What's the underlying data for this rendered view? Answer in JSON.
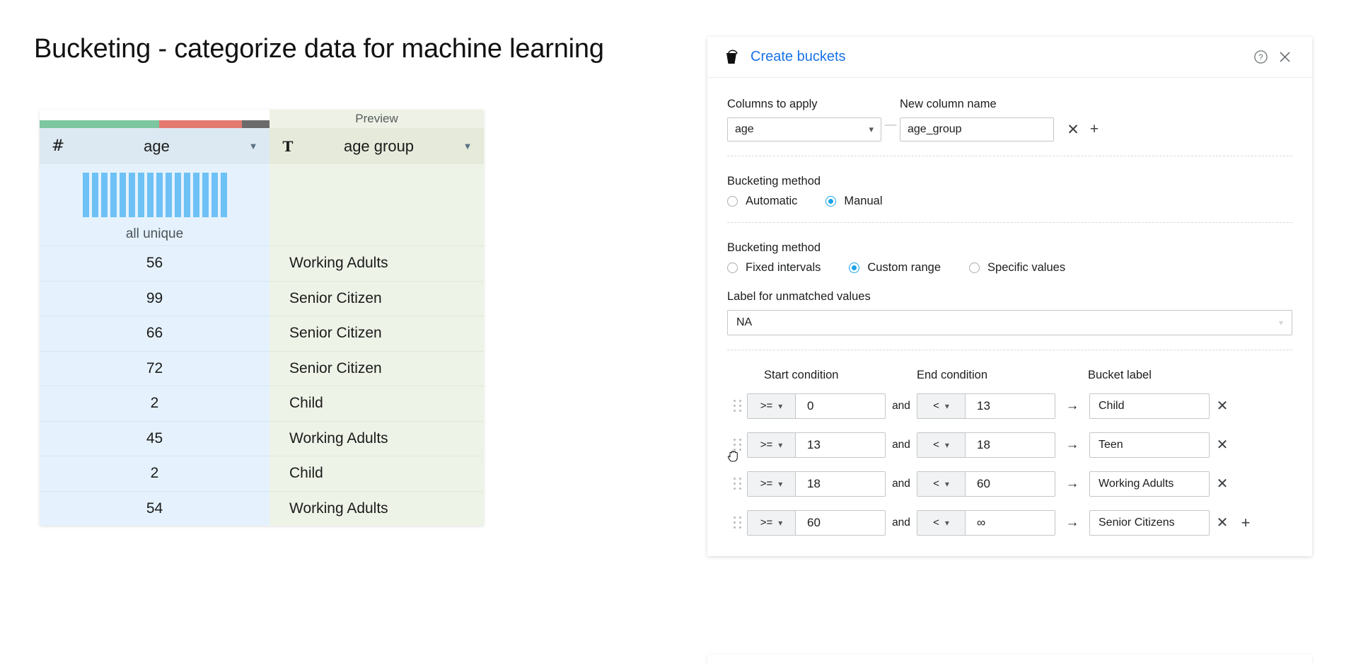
{
  "page": {
    "title": "Bucketing - categorize data for machine learning"
  },
  "table": {
    "preview_label": "Preview",
    "columns": [
      {
        "type_icon": "hash-icon",
        "type_glyph": "#",
        "name": "age",
        "caret": "▼"
      },
      {
        "type_icon": "text-type-icon",
        "type_glyph": "T",
        "name": "age group",
        "caret": "▼"
      }
    ],
    "quality_bar": {
      "green_pct": 52,
      "red_pct": 36,
      "gray_pct": 12,
      "green_color": "#7cc6a0",
      "red_color": "#e4796f",
      "gray_color": "#6b6b6b"
    },
    "histogram": {
      "bar_color": "#6ec1f5",
      "bar_count": 16,
      "summary_label": "all unique"
    },
    "rows": [
      {
        "age": "56",
        "age_group": "Working Adults"
      },
      {
        "age": "99",
        "age_group": "Senior Citizen"
      },
      {
        "age": "66",
        "age_group": "Senior Citizen"
      },
      {
        "age": "72",
        "age_group": "Senior Citizen"
      },
      {
        "age": "2",
        "age_group": "Child"
      },
      {
        "age": "45",
        "age_group": "Working Adults"
      },
      {
        "age": "2",
        "age_group": "Child"
      },
      {
        "age": "54",
        "age_group": "Working Adults"
      }
    ]
  },
  "dialog": {
    "title": "Create buckets",
    "title_color": "#1a73e8",
    "icon": "bucket-icon",
    "help_icon": "help-circle-icon",
    "close_icon": "close-icon",
    "columns_section": {
      "columns_to_apply_label": "Columns to apply",
      "new_column_name_label": "New column name",
      "source_column": "age",
      "join_dash": "—",
      "new_column_name": "age_group",
      "remove_icon": "✕",
      "add_icon": "+"
    },
    "method_section": {
      "label": "Bucketing method",
      "options": [
        {
          "label": "Automatic",
          "selected": false
        },
        {
          "label": "Manual",
          "selected": true
        }
      ]
    },
    "range_section": {
      "label": "Bucketing method",
      "options": [
        {
          "label": "Fixed intervals",
          "selected": false
        },
        {
          "label": "Custom range",
          "selected": true
        },
        {
          "label": "Specific values",
          "selected": false
        }
      ],
      "unmatched_label": "Label for unmatched values",
      "unmatched_value": "NA"
    },
    "rules": {
      "start_header": "Start condition",
      "end_header": "End condition",
      "label_header": "Bucket label",
      "and_word": "and",
      "arrow": "→",
      "remove_icon": "✕",
      "add_icon": "+",
      "items": [
        {
          "start_op": ">=",
          "start_val": "0",
          "end_op": "<",
          "end_val": "13",
          "label": "Child"
        },
        {
          "start_op": ">=",
          "start_val": "13",
          "end_op": "<",
          "end_val": "18",
          "label": "Teen"
        },
        {
          "start_op": ">=",
          "start_val": "18",
          "end_op": "<",
          "end_val": "60",
          "label": "Working Adults"
        },
        {
          "start_op": ">=",
          "start_val": "60",
          "end_op": "<",
          "end_val": "∞",
          "label": "Senior Citizens"
        }
      ]
    }
  },
  "accent": {
    "radio_selected": "#1aa3e8",
    "link_blue": "#1a73e8",
    "histogram_blue": "#6ec1f5"
  }
}
